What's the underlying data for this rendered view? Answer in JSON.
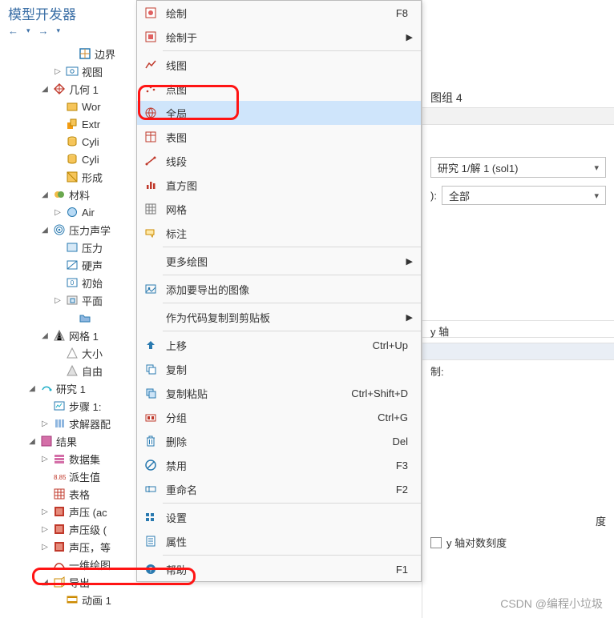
{
  "panel": {
    "title": "模型开发器",
    "nav_back": "←",
    "nav_fwd": "→"
  },
  "tree": {
    "items": [
      {
        "ind": 3,
        "tg": "",
        "ico": "border",
        "label": "边界"
      },
      {
        "ind": 2,
        "tg": "▷",
        "ico": "eye",
        "label": "视图"
      },
      {
        "ind": 1,
        "tg": "◢",
        "ico": "geom",
        "label": "几何 1"
      },
      {
        "ind": 2,
        "tg": "",
        "ico": "wp",
        "label": "Wor"
      },
      {
        "ind": 2,
        "tg": "",
        "ico": "ext",
        "label": "Extr"
      },
      {
        "ind": 2,
        "tg": "",
        "ico": "cyl",
        "label": "Cyli"
      },
      {
        "ind": 2,
        "tg": "",
        "ico": "cyl",
        "label": "Cyli"
      },
      {
        "ind": 2,
        "tg": "",
        "ico": "form",
        "label": "形成"
      },
      {
        "ind": 1,
        "tg": "◢",
        "ico": "mat",
        "label": "材料"
      },
      {
        "ind": 2,
        "tg": "▷",
        "ico": "air",
        "label": "Air"
      },
      {
        "ind": 1,
        "tg": "◢",
        "ico": "acou",
        "label": "压力声学"
      },
      {
        "ind": 2,
        "tg": "",
        "ico": "pres",
        "label": "压力"
      },
      {
        "ind": 2,
        "tg": "",
        "ico": "wall",
        "label": "硬声"
      },
      {
        "ind": 2,
        "tg": "",
        "ico": "init",
        "label": "初始"
      },
      {
        "ind": 2,
        "tg": "▷",
        "ico": "plane",
        "label": "平面"
      },
      {
        "ind": 3,
        "tg": "",
        "ico": "folder",
        "label": ""
      },
      {
        "ind": 1,
        "tg": "◢",
        "ico": "mesh",
        "label": "网格 1"
      },
      {
        "ind": 2,
        "tg": "",
        "ico": "size",
        "label": "大小"
      },
      {
        "ind": 2,
        "tg": "",
        "ico": "ftet",
        "label": "自由"
      },
      {
        "ind": 0,
        "tg": "◢",
        "ico": "study",
        "label": "研究 1"
      },
      {
        "ind": 1,
        "tg": "",
        "ico": "step",
        "label": "步骤 1: "
      },
      {
        "ind": 1,
        "tg": "▷",
        "ico": "solv",
        "label": "求解器配"
      },
      {
        "ind": 0,
        "tg": "◢",
        "ico": "res",
        "label": "结果"
      },
      {
        "ind": 1,
        "tg": "▷",
        "ico": "dset",
        "label": "数据集"
      },
      {
        "ind": 1,
        "tg": "",
        "ico": "deriv",
        "label": "派生值"
      },
      {
        "ind": 1,
        "tg": "",
        "ico": "tbls",
        "label": "表格"
      },
      {
        "ind": 1,
        "tg": "▷",
        "ico": "pg3d",
        "label": "声压 (ac"
      },
      {
        "ind": 1,
        "tg": "▷",
        "ico": "pg3d",
        "label": "声压级 ("
      },
      {
        "ind": 1,
        "tg": "▷",
        "ico": "pg3d",
        "label": "声压，等"
      },
      {
        "ind": 1,
        "tg": "",
        "ico": "pg1d",
        "label": "一维绘图"
      },
      {
        "ind": 1,
        "tg": "◢",
        "ico": "export",
        "label": "导出"
      },
      {
        "ind": 2,
        "tg": "",
        "ico": "anim",
        "label": "动画 1"
      }
    ]
  },
  "menu": {
    "items": [
      {
        "ico": "plot",
        "label": "绘制",
        "shortcut": "F8"
      },
      {
        "ico": "plotin",
        "label": "绘制于",
        "submenu": true
      },
      {
        "sep": true
      },
      {
        "ico": "line",
        "label": "线图"
      },
      {
        "ico": "point",
        "label": "点图"
      },
      {
        "ico": "global",
        "label": "全局",
        "highlight": true
      },
      {
        "ico": "table",
        "label": "表图"
      },
      {
        "ico": "segment",
        "label": "线段"
      },
      {
        "ico": "hist",
        "label": "直方图"
      },
      {
        "ico": "gridm",
        "label": "网格"
      },
      {
        "ico": "annot",
        "label": "标注"
      },
      {
        "sep": true
      },
      {
        "ico": "",
        "label": "更多绘图",
        "submenu": true
      },
      {
        "sep": true
      },
      {
        "ico": "addimg",
        "label": "添加要导出的图像"
      },
      {
        "sep": true
      },
      {
        "ico": "",
        "label": "作为代码复制到剪贴板",
        "submenu": true
      },
      {
        "sep": true
      },
      {
        "ico": "up",
        "label": "上移",
        "shortcut": "Ctrl+Up"
      },
      {
        "ico": "copy",
        "label": "复制"
      },
      {
        "ico": "dup",
        "label": "复制粘贴",
        "shortcut": "Ctrl+Shift+D"
      },
      {
        "ico": "group",
        "label": "分组",
        "shortcut": "Ctrl+G"
      },
      {
        "ico": "del",
        "label": "删除",
        "shortcut": "Del"
      },
      {
        "ico": "disable",
        "label": "禁用",
        "shortcut": "F3"
      },
      {
        "ico": "rename",
        "label": "重命名",
        "shortcut": "F2"
      },
      {
        "sep": true
      },
      {
        "ico": "settings",
        "label": "设置"
      },
      {
        "ico": "props",
        "label": "属性"
      },
      {
        "sep": true
      },
      {
        "ico": "help",
        "label": "帮助",
        "shortcut": "F1"
      }
    ]
  },
  "props": {
    "title_suffix": "图组 4",
    "dataset_label": "研究 1/解 1 (sol1)",
    "colon": "):",
    "all_label": "全部",
    "y_axis_section": "y 轴",
    "control_colon": "制:",
    "du_suffix": "度",
    "ylog": "y 轴对数刻度"
  },
  "watermark": "CSDN @编程小垃圾"
}
